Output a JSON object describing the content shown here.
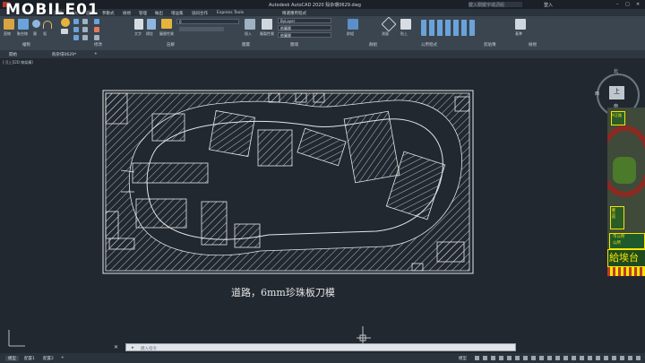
{
  "watermark": {
    "text": "MOBILE01"
  },
  "titlebar": {
    "title": "Autodesk AutoCAD 2020   殼杂環0629.dwg",
    "search_placeholder": "鍵入關鍵字或詞組",
    "user": "登入"
  },
  "ribbon_tabs": [
    "常用",
    "插入",
    "註解",
    "參數式",
    "檢視",
    "管理",
    "輸出",
    "增益集",
    "協同合作",
    "Express Tools",
    "精選應用程式"
  ],
  "ribbon": {
    "groups": [
      "繪製",
      "修改",
      "註解",
      "圖層",
      "圖塊",
      "性質",
      "群組",
      "公用程式",
      "剪貼簿",
      "檢視"
    ],
    "buttons": {
      "line": "直線",
      "polyline": "聚合線",
      "circle": "圓",
      "arc": "弧",
      "text": "文字",
      "dimension": "標註",
      "layer_properties": "圖層性質",
      "insert": "插入",
      "match_properties": "複製性質",
      "group": "群組",
      "measure": "測量",
      "paste": "貼上",
      "base": "基準"
    },
    "layer_combo": "0",
    "color_combo": "ByLayer",
    "linetype_combo": "依圖層",
    "lineweight_combo": "依圖層"
  },
  "doc_tabs": {
    "start": "開始",
    "file": "殼杂環0629*",
    "add": "+"
  },
  "view_label": "[-][上][2D 線架構]",
  "viewcube": {
    "north": "北",
    "west": "西",
    "top": "上",
    "south": "南",
    "wcs": "WCS"
  },
  "caption": "道路，6mm珍珠板刀模",
  "cmdline": {
    "placeholder": "鍵入指令"
  },
  "status": {
    "model": "模型",
    "layout1": "配置1",
    "layout2": "配置2",
    "add": "+",
    "model_right": "模型"
  },
  "right_panel": {
    "sign1": "中正路",
    "sign2": "鄉公所",
    "sign3": "市公所",
    "sign4": "公所",
    "sign5": "給埃台",
    "colors": {
      "yellow": "#f2e600",
      "green": "#4a7a2a",
      "red": "#c0392b"
    }
  },
  "colors": {
    "canvas": "#212830",
    "ribbon": "#3b4550",
    "drawing": "#e6e6e6"
  }
}
